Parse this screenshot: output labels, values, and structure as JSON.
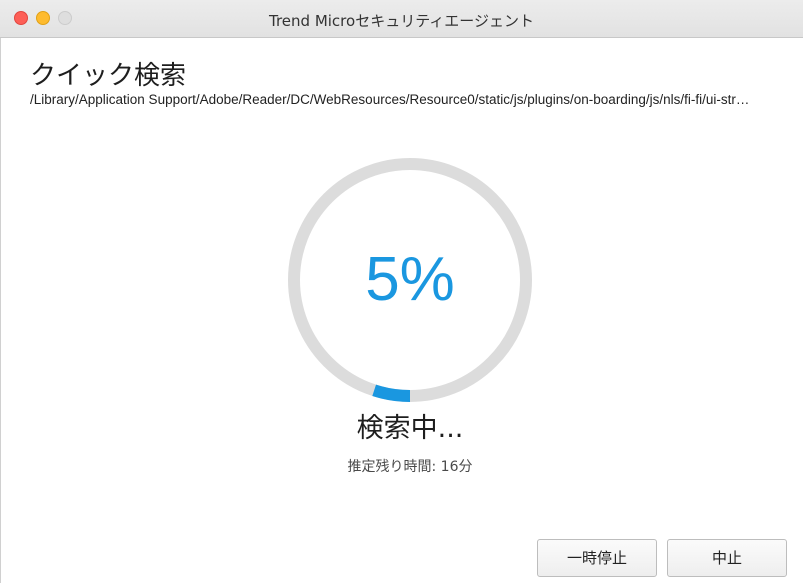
{
  "window": {
    "title": "Trend Microセキュリティエージェント"
  },
  "header": {
    "title": "クイック検索",
    "current_path": "/Library/Application Support/Adobe/Reader/DC/WebResources/Resource0/static/js/plugins/on-boarding/js/nls/fi-fi/ui-str…"
  },
  "progress": {
    "percent": 5,
    "percent_label": "5%",
    "status": "検索中...",
    "remaining_time": "推定残り時間: 16分",
    "color_fill": "#1a97e0",
    "color_track": "#dcdcdc"
  },
  "buttons": {
    "pause_label": "一時停止",
    "stop_label": "中止"
  },
  "icons": {
    "close": "close-icon",
    "minimize": "minimize-icon",
    "zoom": "zoom-icon"
  }
}
